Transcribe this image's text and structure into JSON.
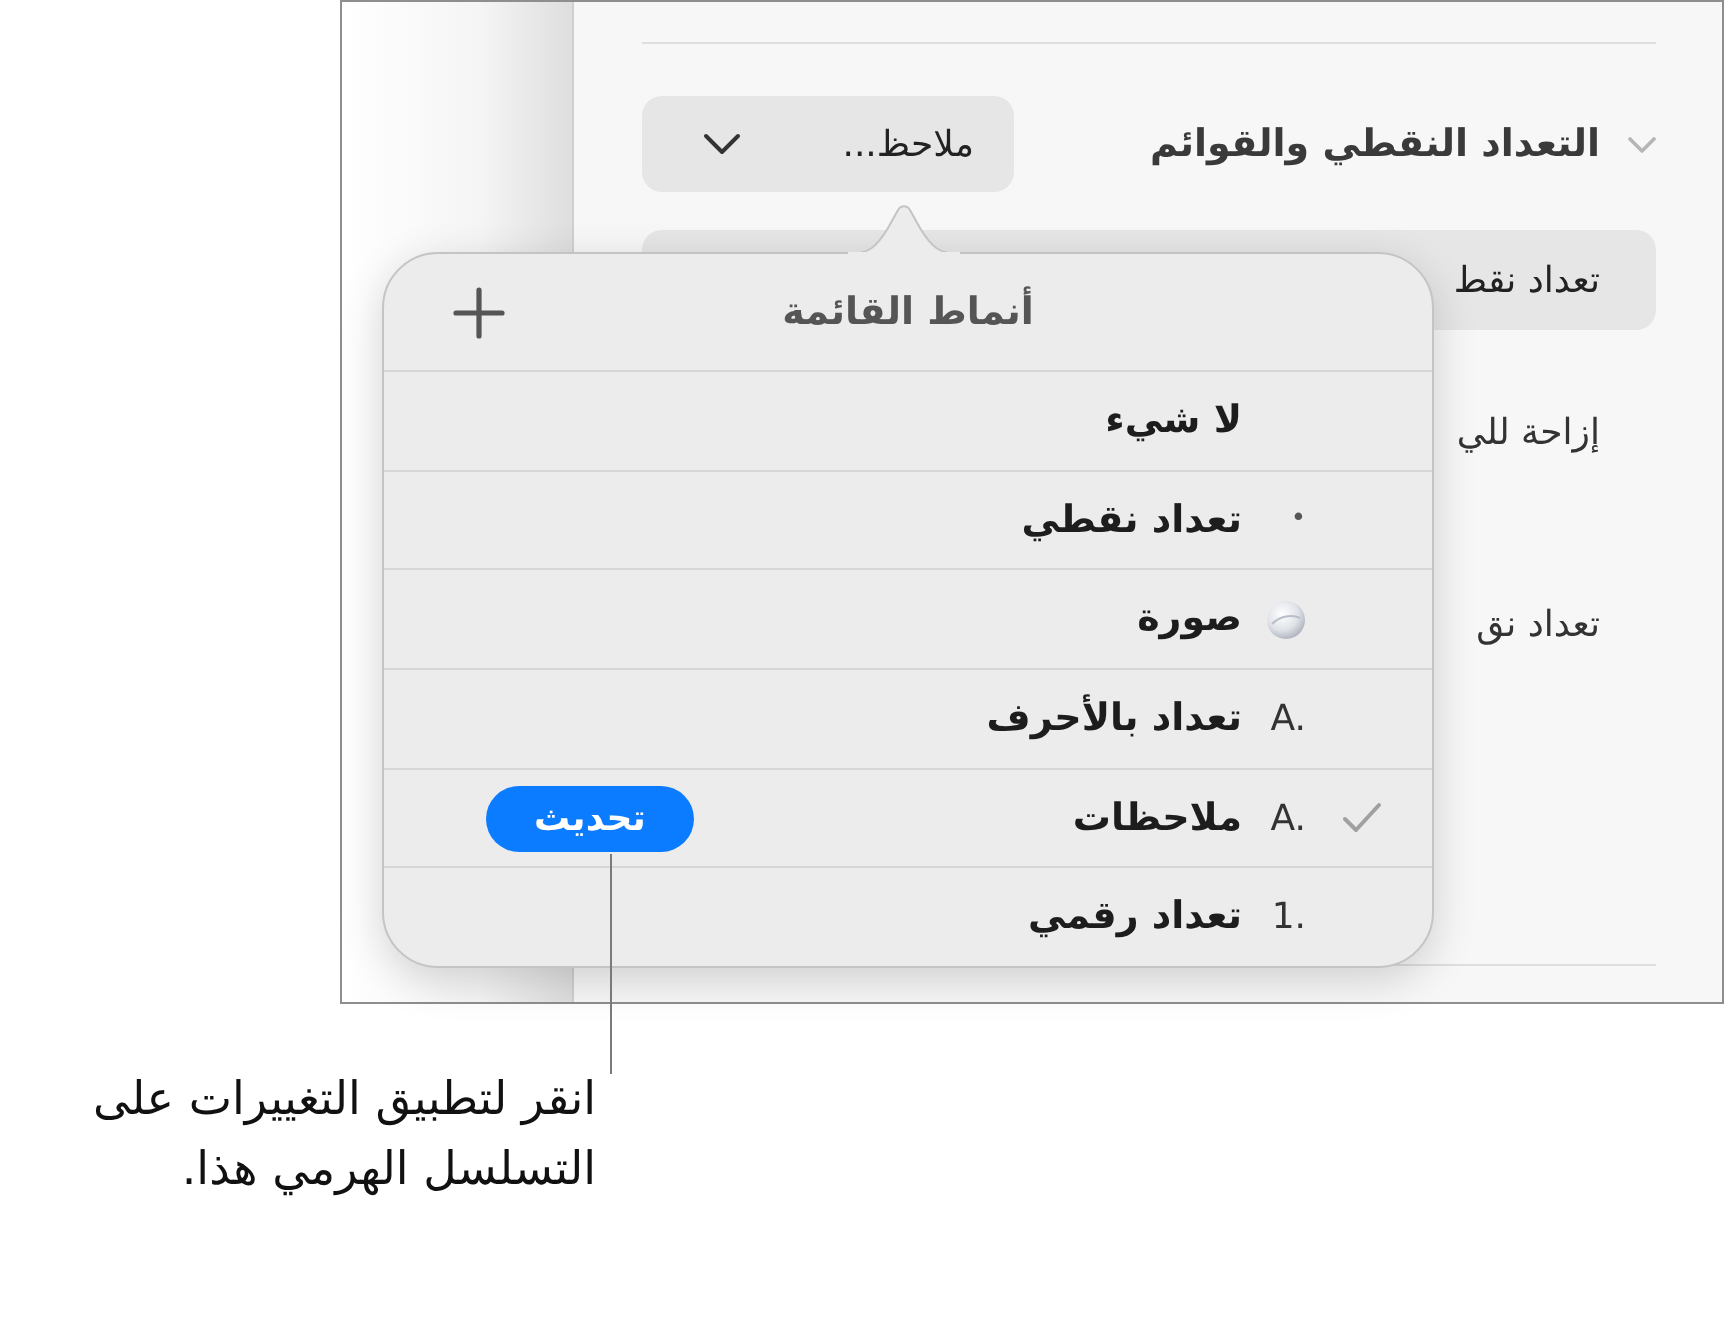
{
  "panel": {
    "section": {
      "title": "التعداد النقطي والقوائم",
      "expanded": true,
      "style_menu": {
        "value": "ملاحظ..."
      }
    },
    "rows": [
      {
        "kind": "field",
        "text": "تعداد نقط"
      },
      {
        "kind": "label",
        "text": "إزاحة للي"
      },
      {
        "kind": "label",
        "text": "تعداد نق"
      }
    ]
  },
  "popover": {
    "title": "أنماط القائمة",
    "items": [
      {
        "kind": "plain",
        "label": "لا شيء",
        "selected": false
      },
      {
        "kind": "marker",
        "marker": "•",
        "label": "تعداد نقطي",
        "selected": false
      },
      {
        "kind": "image",
        "label": "صورة",
        "selected": false
      },
      {
        "kind": "marker",
        "marker": "A.",
        "label": "تعداد بالأحرف",
        "selected": false
      },
      {
        "kind": "marker",
        "marker": "A.",
        "label": "ملاحظات",
        "selected": true,
        "update_button": "تحديث"
      },
      {
        "kind": "marker",
        "marker": "1.",
        "label": "تعداد رقمي",
        "selected": false
      }
    ]
  },
  "callout": {
    "text": "انقر لتطبيق التغييرات على التسلسل الهرمي هذا."
  }
}
